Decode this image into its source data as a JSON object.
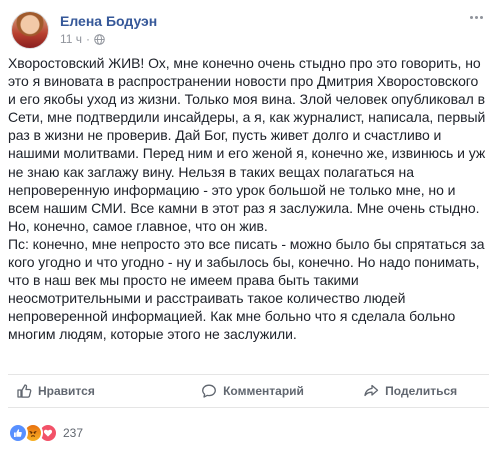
{
  "post": {
    "author": "Елена Бодуэн",
    "time": "11 ч",
    "separator": "·",
    "privacy_icon": "globe-icon",
    "more_icon": "more-options-icon",
    "paragraphs": [
      "Хворостовский ЖИВ! Ох, мне конечно очень стыдно про это говорить, но это я виновата в распространении новости про Дмитрия Хворостовского и его якобы уход из жизни. Только моя вина. Злой человек опубликовал в Сети, мне подтвердили инсайдеры, а я, как журналист, написала, первый раз в жизни не проверив. Дай Бог, пусть живет долго и счастливо и нашими молитвами. Перед ним и его женой я, конечно же, извинюсь и уж не знаю как заглажу вину. Нельзя в таких вещах полагаться на непроверенную информацию - это урок большой не только мне, но и всем нашим СМИ. Все камни в этот раз я заслужила. Мне очень стыдно. Но, конечно, самое главное, что он жив.",
      "Пс: конечно, мне непросто это все писать - можно было бы спрятаться за кого угодно и что угодно - ну и забылось бы, конечно. Но надо понимать, что в наш век мы просто не имеем права быть такими неосмотрительными и расстраивать такое количество людей непроверенной информацией. Как мне больно что я сделала больно многим людям, которые этого не заслужили."
    ]
  },
  "actions": {
    "like_label": "Нравится",
    "comment_label": "Комментарий",
    "share_label": "Поделиться"
  },
  "reactions": {
    "types": [
      "like",
      "angry",
      "love"
    ],
    "count": "237"
  },
  "colors": {
    "author_link": "#365899",
    "meta_gray": "#90949c",
    "action_gray": "#616770",
    "like_blue": "#5890ff",
    "love_red": "#f25268"
  }
}
